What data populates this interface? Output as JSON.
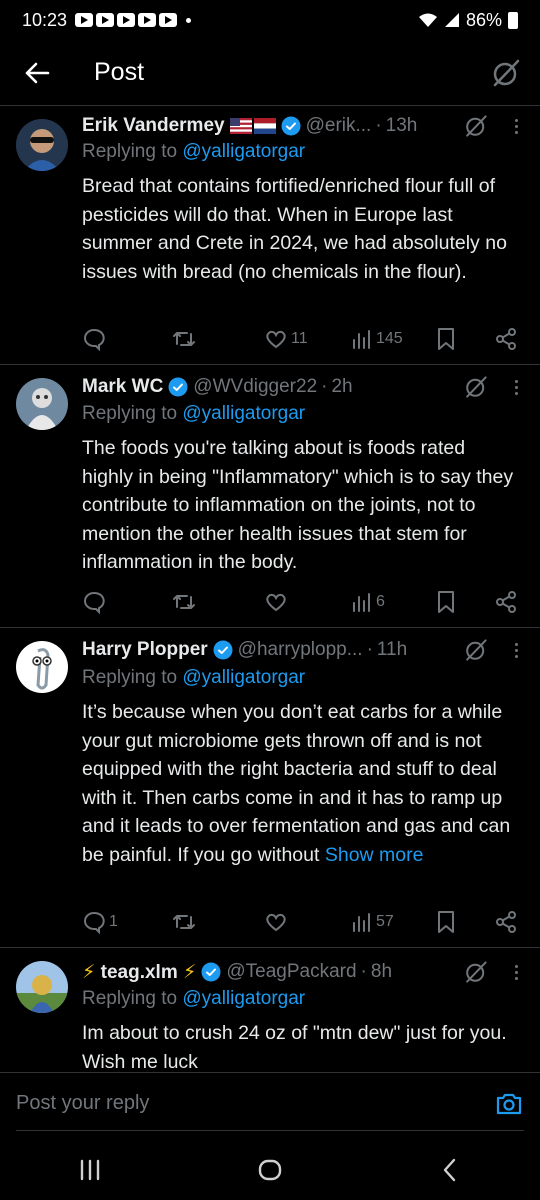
{
  "status_bar": {
    "time": "10:23",
    "battery": "86%"
  },
  "header": {
    "title": "Post"
  },
  "tweets": [
    {
      "name": "Erik Vandermey",
      "handle": "@erik...",
      "time": "13h",
      "replying_prefix": "Replying to",
      "replying_to": "@yalligatorgar",
      "body": "Bread that contains fortified/enriched flour full of pesticides will do that. When in Europe last summer and Crete in 2024, we had absolutely no issues with bread (no chemicals in the flour).",
      "replies": "",
      "retweets": "",
      "likes": "11",
      "views": "145"
    },
    {
      "name": "Mark WC",
      "handle": "@WVdigger22",
      "time": "2h",
      "replying_prefix": "Replying to",
      "replying_to": "@yalligatorgar",
      "body": "The foods you're talking about is foods rated highly in being \"Inflammatory\" which is to say they contribute to inflammation on the joints, not to mention the other health issues that stem for inflammation in the body.",
      "replies": "",
      "retweets": "",
      "likes": "",
      "views": "6"
    },
    {
      "name": "Harry Plopper",
      "handle": "@harryplopp...",
      "time": "11h",
      "replying_prefix": "Replying to",
      "replying_to": "@yalligatorgar",
      "body": "It’s because when you don’t eat carbs for a while your gut microbiome gets thrown off and is not equipped with the right bacteria and stuff to deal with it. Then carbs come in and it has to ramp up and it leads to over fermentation and gas and can be painful. If you go without",
      "show_more": "Show more",
      "replies": "1",
      "retweets": "",
      "likes": "",
      "views": "57"
    },
    {
      "name": "teag.xlm",
      "name_prefix": "⚡",
      "name_suffix": "⚡",
      "handle": "@TeagPackard",
      "time": "8h",
      "replying_prefix": "Replying to",
      "replying_to": "@yalligatorgar",
      "body": "Im about to crush 24 oz of \"mtn dew\" just for you. Wish me luck"
    }
  ],
  "reply_bar": {
    "placeholder": "Post your reply"
  },
  "colors": {
    "background": "#000000",
    "accent": "#1d9bf0",
    "muted": "#71767b",
    "text": "#e7e9ea",
    "border": "#2f3336"
  }
}
